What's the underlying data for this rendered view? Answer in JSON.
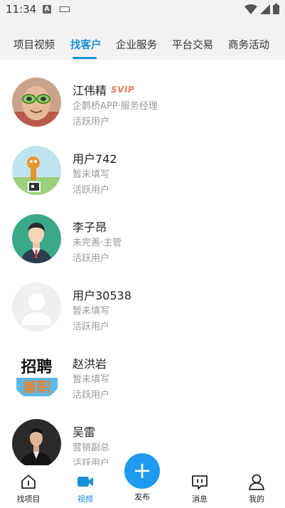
{
  "status_bar": {
    "time": "11:34",
    "input_icon_letter": "A"
  },
  "tabs": [
    {
      "label": "项目视频",
      "active": false
    },
    {
      "label": "找客户",
      "active": true
    },
    {
      "label": "企业服务",
      "active": false
    },
    {
      "label": "平台交易",
      "active": false
    },
    {
      "label": "商务活动",
      "active": false
    }
  ],
  "users": [
    {
      "name": "江伟精",
      "badge": "SVIP",
      "subtitle": "企鹊桥APP·服务经理",
      "status": "活跃用户",
      "avatar_icon": "photo-avatar-icon"
    },
    {
      "name": "用户742",
      "badge": "",
      "subtitle": "暂未填写",
      "status": "活跃用户",
      "avatar_icon": "cartoon-avatar-icon"
    },
    {
      "name": "李子昂",
      "badge": "",
      "subtitle": "未完善·主管",
      "status": "活跃用户",
      "avatar_icon": "businessman-avatar-icon"
    },
    {
      "name": "用户30538",
      "badge": "",
      "subtitle": "暂未填写",
      "status": "活跃用户",
      "avatar_icon": "default-avatar-icon"
    },
    {
      "name": "赵洪岩",
      "badge": "",
      "subtitle": "暂未填写",
      "status": "活跃用户",
      "avatar_icon": "recruit-avatar-icon"
    },
    {
      "name": "吴雷",
      "badge": "",
      "subtitle": "营销副总",
      "status": "活跃用户",
      "avatar_icon": "suit-avatar-icon"
    }
  ],
  "recruit_avatar_text": {
    "line1": "招聘",
    "line2": "兼职"
  },
  "bottom_nav": {
    "items": [
      {
        "label": "找项目",
        "icon": "project-icon",
        "active": false
      },
      {
        "label": "视频",
        "icon": "video-icon",
        "active": true
      },
      {
        "label": "发布",
        "icon": "plus-icon",
        "active": false
      },
      {
        "label": "消息",
        "icon": "message-icon",
        "active": false
      },
      {
        "label": "我的",
        "icon": "profile-icon",
        "active": false
      }
    ]
  },
  "colors": {
    "accent": "#1a8fd8",
    "publish": "#1e9af0",
    "svip": "#f07a5a",
    "muted_text": "#999999"
  }
}
